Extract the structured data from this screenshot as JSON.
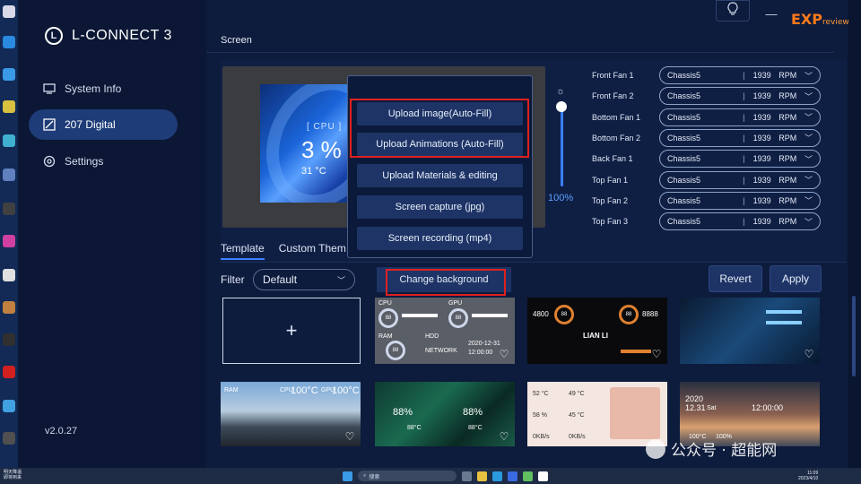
{
  "app": {
    "title": "L-CONNECT 3",
    "logo_glyph": "L",
    "version": "v2.0.27"
  },
  "sidebar": {
    "items": [
      {
        "label": "System Info",
        "icon": "monitor-icon"
      },
      {
        "label": "207 Digital",
        "icon": "display-icon",
        "active": true
      },
      {
        "label": "Settings",
        "icon": "gear-icon"
      }
    ]
  },
  "titlebar": {
    "bulb_icon": "lightbulb-icon",
    "minimize": "—",
    "watermark": "EXP",
    "watermark_sub": "review"
  },
  "screen": {
    "section_title": "Screen",
    "preview": {
      "cpu_label": "[ CPU ]",
      "cpu_value": "3 %",
      "cpu_temp": "31 °C"
    },
    "brightness_value": "100%"
  },
  "fans": [
    {
      "name": "Front Fan 1",
      "mode": "Chassis5",
      "rpm": "1939",
      "unit": "RPM"
    },
    {
      "name": "Front Fan 2",
      "mode": "Chassis5",
      "rpm": "1939",
      "unit": "RPM"
    },
    {
      "name": "Bottom Fan 1",
      "mode": "Chassis5",
      "rpm": "1939",
      "unit": "RPM"
    },
    {
      "name": "Bottom Fan 2",
      "mode": "Chassis5",
      "rpm": "1939",
      "unit": "RPM"
    },
    {
      "name": "Back Fan 1",
      "mode": "Chassis5",
      "rpm": "1939",
      "unit": "RPM"
    },
    {
      "name": "Top Fan 1",
      "mode": "Chassis5",
      "rpm": "1939",
      "unit": "RPM"
    },
    {
      "name": "Top Fan 2",
      "mode": "Chassis5",
      "rpm": "1939",
      "unit": "RPM"
    },
    {
      "name": "Top Fan 3",
      "mode": "Chassis5",
      "rpm": "1939",
      "unit": "RPM"
    }
  ],
  "upload_menu": {
    "items": [
      "Upload image(Auto-Fill)",
      "Upload Animations (Auto-Fill)",
      "Upload Materials & editing",
      "Screen capture (jpg)",
      "Screen recording (mp4)"
    ]
  },
  "tabs": [
    "Template",
    "Custom Them"
  ],
  "filter": {
    "label": "Filter",
    "value": "Default"
  },
  "actions": {
    "change_background": "Change background",
    "revert": "Revert",
    "apply": "Apply"
  },
  "templates": {
    "add_symbol": "+",
    "tile2": {
      "cpu": "CPU",
      "gpu": "GPU",
      "ram": "RAM",
      "hdd": "HDD",
      "network": "NETWORK",
      "ring": "88",
      "date": "2020-12-31",
      "time": "12:00:00"
    },
    "tile3": {
      "brand": "LIAN LI",
      "left_val": "4800",
      "right_val": "8888",
      "ring": "88"
    },
    "tile5": {
      "ram": "RAM",
      "cpu": "CPU",
      "gpu": "GPU",
      "cpu_temp": "100°C",
      "gpu_temp": "100°C"
    },
    "tile6": {
      "cpu": "88%",
      "gpu": "88%",
      "temp": "88°C"
    },
    "tile7": {
      "t1": "52 °C",
      "t2": "49 °C",
      "t3": "58 %",
      "t4": "45 °C",
      "s1": "0KB/s",
      "s2": "0KB/s"
    },
    "tile8": {
      "date": "2020",
      "date2": "12.31",
      "time": "12:00:00",
      "day": "Sat",
      "val1": "100°C",
      "val2": "100%"
    }
  },
  "watermark_bottom": "公众号 · 超能网",
  "taskbar": {
    "weather_line1": "明天降温",
    "weather_line2": "即将到来",
    "search": "搜索",
    "time": "11:09",
    "date": "2023/4/10"
  },
  "colors": {
    "accent": "#3b80ff",
    "highlight_box": "#e02020",
    "window_bg": "#0d1b3c"
  }
}
